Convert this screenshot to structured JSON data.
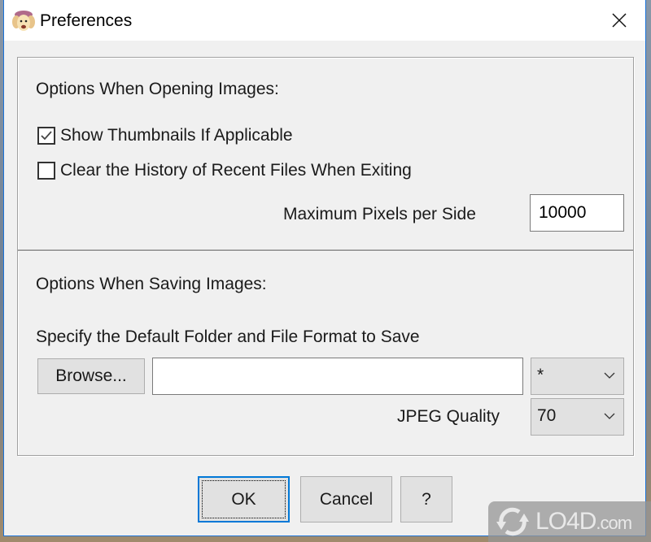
{
  "window": {
    "title": "Preferences",
    "icon": "dog-app-icon",
    "close_icon": "close-icon"
  },
  "opening": {
    "heading": "Options When Opening Images:",
    "show_thumbnails": {
      "label": "Show Thumbnails If Applicable",
      "checked": true
    },
    "clear_history": {
      "label": "Clear the History of Recent Files When Exiting",
      "checked": false
    },
    "max_pixels_label": "Maximum Pixels per Side",
    "max_pixels_value": "10000"
  },
  "saving": {
    "heading": "Options When Saving Images:",
    "folder_label": "Specify the Default Folder and File Format to Save",
    "browse_label": "Browse...",
    "folder_value": "",
    "format_value": "*",
    "jpeg_quality_label": "JPEG Quality",
    "jpeg_quality_value": "70"
  },
  "buttons": {
    "ok": "OK",
    "cancel": "Cancel",
    "help": "?"
  },
  "watermark": {
    "text": "LO4D",
    "suffix": ".com"
  }
}
